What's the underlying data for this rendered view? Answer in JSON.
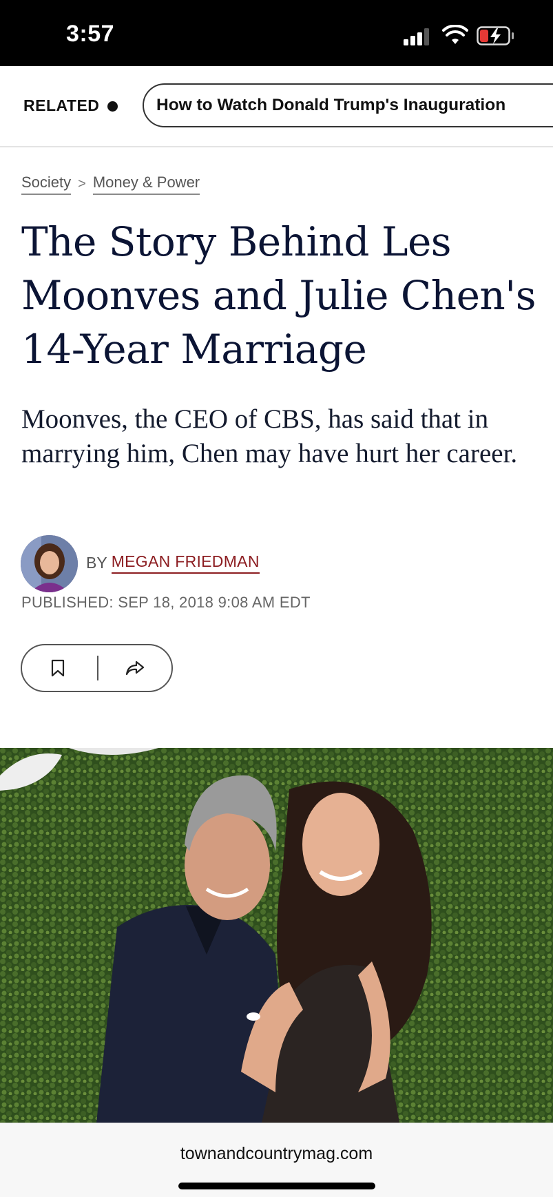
{
  "status_bar": {
    "time": "3:57",
    "icons": [
      "cellular-signal-icon",
      "wifi-icon",
      "battery-charging-icon"
    ],
    "battery_color": "#e53935"
  },
  "related": {
    "label": "RELATED",
    "link_text": "How to Watch Donald Trump's Inauguration"
  },
  "breadcrumb": {
    "section": "Society",
    "separator": ">",
    "subsection": "Money & Power"
  },
  "article": {
    "headline": "The Story Behind Les Moonves and Julie Chen's 14-Year Marriage",
    "dek": "Moonves, the CEO of CBS, has said that in marrying him, Chen may have hurt her career.",
    "byline_prefix": "BY",
    "author": "MEGAN FRIEDMAN",
    "published": "PUBLISHED: SEP 18, 2018 9:08 AM EDT"
  },
  "actions": {
    "icons": [
      "bookmark-icon",
      "share-icon"
    ]
  },
  "hero_image": {
    "subject": "photo-les-moonves-julie-chen"
  },
  "browser": {
    "url": "townandcountrymag.com"
  },
  "colors": {
    "headline": "#0b1434",
    "author_link": "#8c1d21"
  }
}
